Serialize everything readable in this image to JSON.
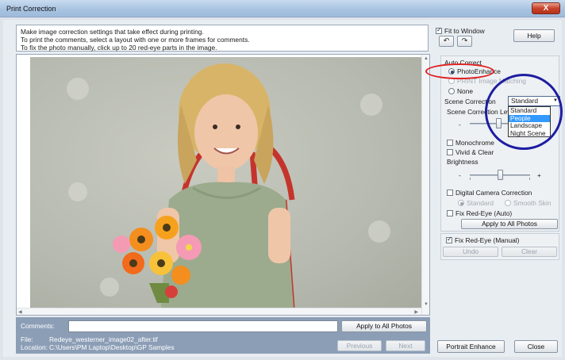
{
  "window": {
    "title": "Print Correction",
    "close_glyph": "X"
  },
  "instructions": [
    "Make image correction settings that take effect during printing.",
    "To print the comments, select a layout with one or more frames for comments.",
    "To fix the photo manually, click up to 20 red-eye parts in the image."
  ],
  "view": {
    "fit_to_window_label": "Fit to Window",
    "fit_to_window_checked": true,
    "help_label": "Help"
  },
  "auto_correct": {
    "heading": "Auto Correct",
    "modes": [
      {
        "label": "PhotoEnhance",
        "selected": true,
        "enabled": true
      },
      {
        "label": "PRINT Image Matching",
        "selected": false,
        "enabled": false
      },
      {
        "label": "None",
        "selected": false,
        "enabled": true
      }
    ],
    "scene_correction_label": "Scene Correction",
    "scene_correction_value": "Standard",
    "scene_options": [
      "Standard",
      "People",
      "Landscape",
      "Night Scene"
    ],
    "scene_highlighted": "People",
    "scene_level_label": "Scene Correction Level",
    "scene_level_minus": "-",
    "monochrome_label": "Monochrome",
    "vivid_label": "Vivid & Clear",
    "brightness_label": "Brightness",
    "brightness_minus": "-",
    "brightness_plus": "+",
    "digital_camera_label": "Digital Camera Correction",
    "dc_standard_label": "Standard",
    "dc_smooth_label": "Smooth Skin",
    "fix_redeye_auto_label": "Fix Red-Eye (Auto)",
    "apply_all_label": "Apply to All Photos"
  },
  "manual": {
    "fix_redeye_manual_label": "Fix Red-Eye (Manual)",
    "fix_redeye_manual_checked": true,
    "undo_label": "Undo",
    "clear_label": "Clear"
  },
  "bottom": {
    "comments_label": "Comments:",
    "comments_value": "",
    "apply_all_label": "Apply to All Photos",
    "file_label": "File:",
    "file_value": "Redeye_westerner_image02_after.tif",
    "location_label": "Location:",
    "location_value": "C:\\Users\\PM Laptop\\Desktop\\GP Samples",
    "previous_label": "Previous",
    "next_label": "Next"
  },
  "footer": {
    "portrait_enhance_label": "Portrait Enhance",
    "close_label": "Close"
  },
  "colors": {
    "title_bar": "#a9c4e2",
    "bottom_panel": "#8c9eb6",
    "highlight": "#3399ff",
    "annotation_red": "#e02020",
    "annotation_blue": "#1e1ea0"
  }
}
